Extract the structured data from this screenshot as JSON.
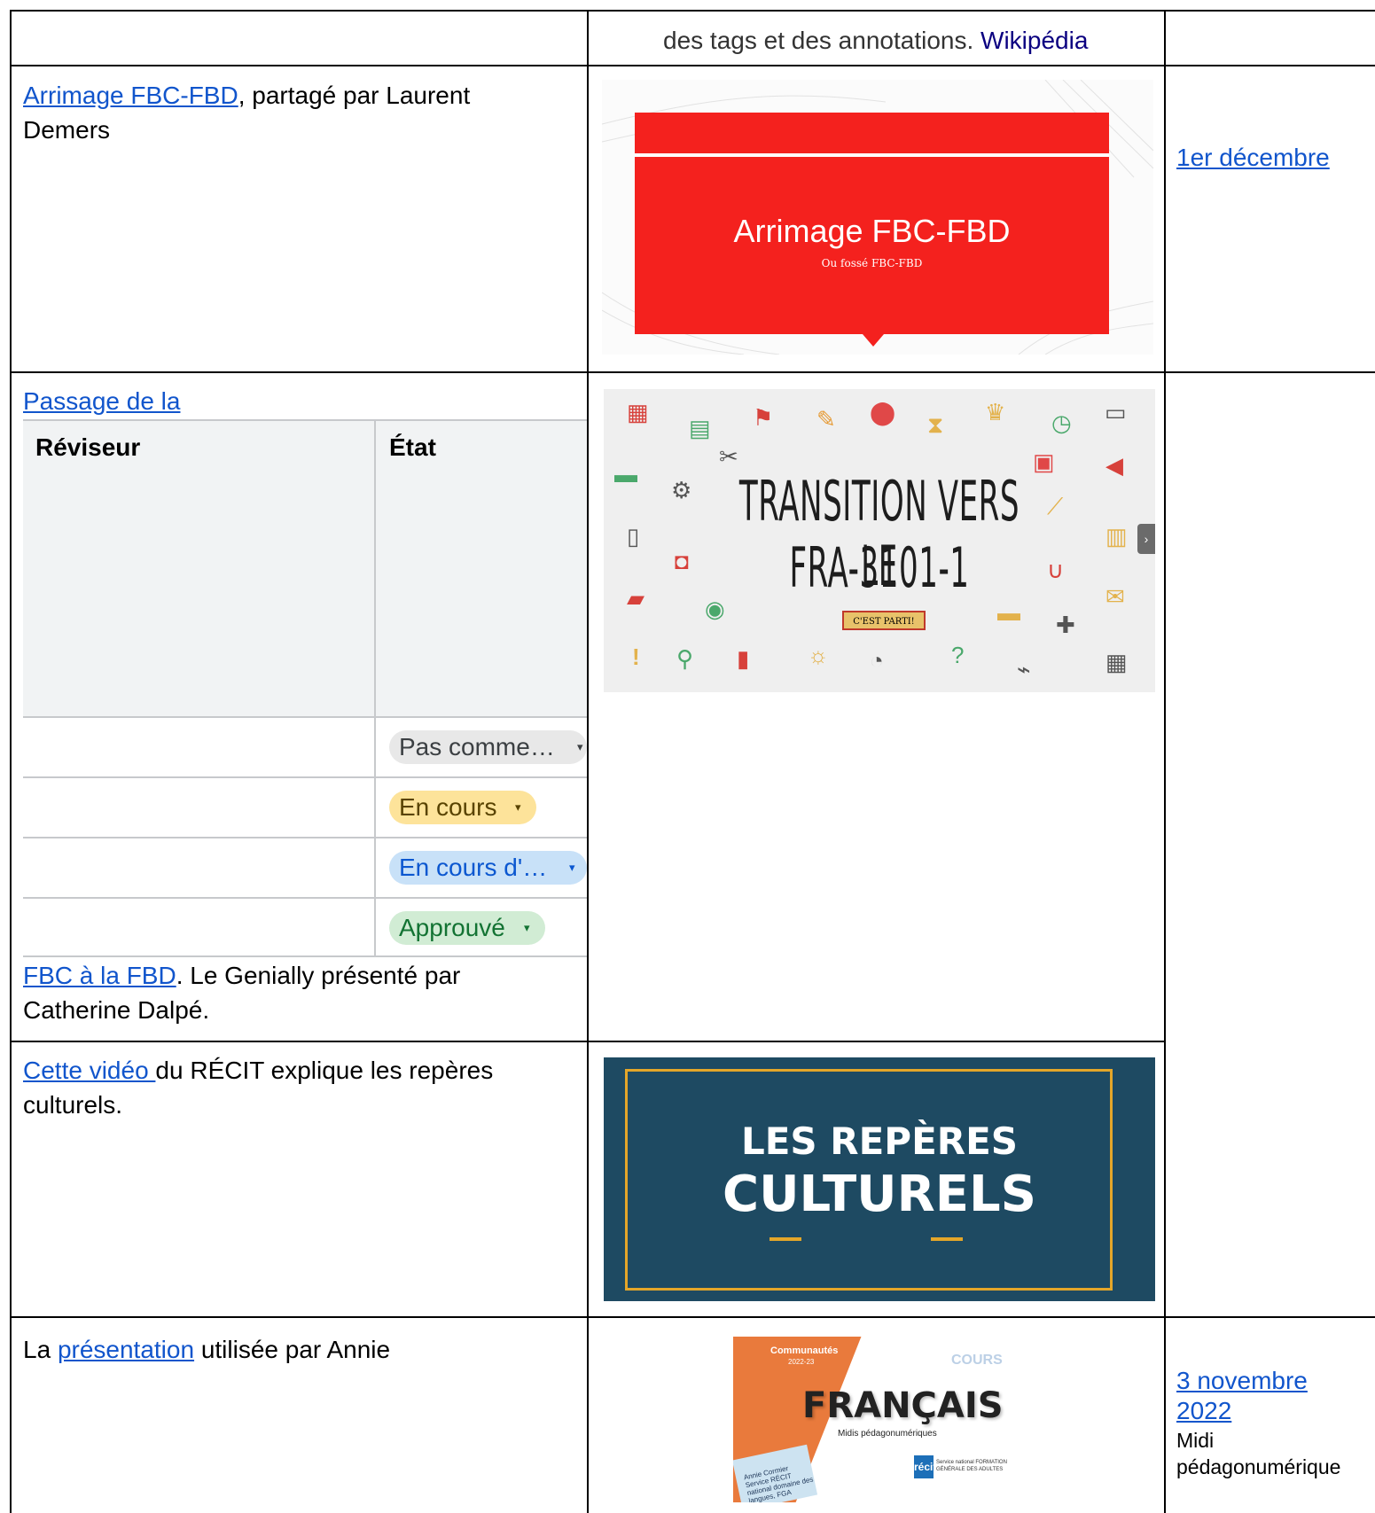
{
  "row0": {
    "description_prefix": "des tags et des annotations. ",
    "wiki_link": "Wikipédia"
  },
  "row1": {
    "link": "Arrimage FBC-FBD",
    "text": ", partagé par Laurent Demers",
    "date_link": "1er décembre",
    "slide": {
      "title": "Arrimage FBC-FBD",
      "subtitle": "Ou fossé FBC-FBD",
      "color": "#f4211e"
    }
  },
  "row2": {
    "link_start": "Passage de la",
    "review_table": {
      "headers": [
        "Réviseur",
        "État"
      ],
      "statuses": [
        {
          "label": "Pas comme…",
          "color": "#e8e8e8"
        },
        {
          "label": "En cours",
          "color": "#fde39a"
        },
        {
          "label": "En cours d'…",
          "color": "#c8e1f8"
        },
        {
          "label": "Approuvé",
          "color": "#d1ecd4"
        }
      ]
    },
    "link_end": "FBC à la FBD",
    "text": ". Le Genially présenté par Catherine Dalpé.",
    "slide": {
      "line1": "TRANSITION VERS LE",
      "line2": "FRA-3101-1",
      "button": "C'EST PARTI!"
    }
  },
  "row3": {
    "link": "Cette vidéo ",
    "text": "du RÉCIT explique les repères culturels.",
    "slide": {
      "line1": "LES REPÈRES",
      "line2": "CULTURELS"
    }
  },
  "row4": {
    "text_prefix": "La ",
    "link": "présentation",
    "text_suffix": " utilisée par Annie",
    "date_link": "3 novembre 2022",
    "date_note": "Midi pédagonumérique",
    "slide": {
      "top": "Communautés",
      "year": "2022-23",
      "title": "FRANÇAIS",
      "subtitle": "Midis pédagonumériques",
      "card": "Annie Cormier Service RÉCIT national domaine des langues, FGA",
      "logo": "récit",
      "logo_text": "Service national FORMATION GÉNÉRALE DES ADULTES",
      "cours": "COURS"
    }
  }
}
